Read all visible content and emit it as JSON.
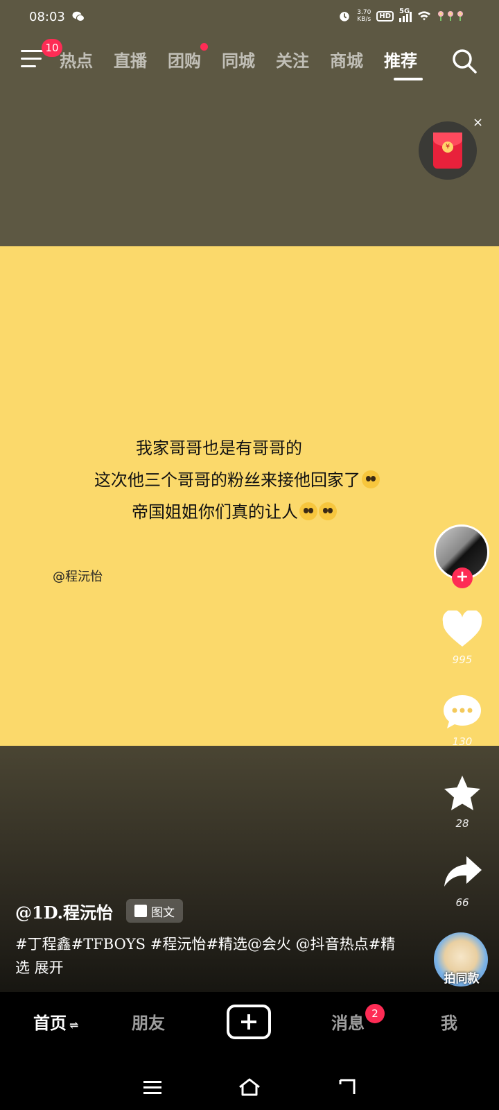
{
  "status_bar": {
    "time": "08:03",
    "net_speed_top": "3.70",
    "net_speed_unit": "KB/s",
    "hd_label": "HD",
    "network": "5G"
  },
  "top_nav": {
    "menu_badge": "10",
    "tabs": [
      {
        "label": "热点",
        "active": false,
        "dot": false
      },
      {
        "label": "直播",
        "active": false,
        "dot": false
      },
      {
        "label": "团购",
        "active": false,
        "dot": true
      },
      {
        "label": "同城",
        "active": false,
        "dot": false
      },
      {
        "label": "关注",
        "active": false,
        "dot": false
      },
      {
        "label": "商城",
        "active": false,
        "dot": false
      },
      {
        "label": "推荐",
        "active": true,
        "dot": false
      }
    ]
  },
  "red_packet": {
    "icon": "red-envelope-icon",
    "coin_symbol": "¥",
    "close_symbol": "×"
  },
  "content": {
    "line1": "我家哥哥也是有哥哥的",
    "line2": "这次他三个哥哥的粉丝来接他回家了",
    "line3": "帝国姐姐你们真的让人",
    "watermark": "@程沅怡",
    "background_color": "#fbd96b"
  },
  "actions": {
    "likes": "995",
    "comments": "130",
    "favorites": "28",
    "shares": "66"
  },
  "caption": {
    "author": "@1D.程沅怡",
    "image_tag": "图文",
    "description": "#丁程鑫#TFBOYS #程沅怡#精选@会火 @抖音热点#精选 展开",
    "same_style_label": "拍同款"
  },
  "bottom_nav": {
    "home": "首页",
    "home_suffix": "⇌",
    "friends": "朋友",
    "messages": "消息",
    "messages_badge": "2",
    "me": "我"
  },
  "colors": {
    "accent": "#fe2c55",
    "text_on_card": "#111111"
  }
}
